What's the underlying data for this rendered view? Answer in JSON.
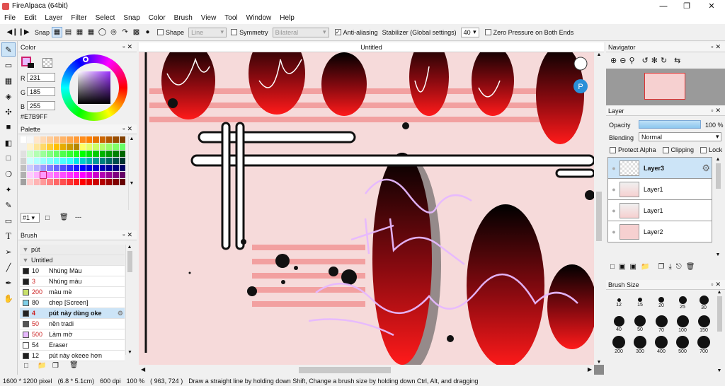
{
  "app": {
    "title": "FireAlpaca (64bit)"
  },
  "menu": [
    "File",
    "Edit",
    "Layer",
    "Filter",
    "Select",
    "Snap",
    "Color",
    "Brush",
    "View",
    "Tool",
    "Window",
    "Help"
  ],
  "toolbar": {
    "snap_label": "Snap",
    "shape_label": "Shape",
    "shape_value": "Line",
    "symmetry_label": "Symmetry",
    "symmetry_value": "Bilateral",
    "antialias_label": "Anti-aliasing",
    "stabilizer_label": "Stabilizer (Global settings)",
    "stabilizer_value": "40",
    "zero_pressure_label": "Zero Pressure on Both Ends"
  },
  "color_panel": {
    "title": "Color",
    "r_label": "R",
    "g_label": "G",
    "b_label": "B",
    "r": "231",
    "g": "185",
    "b": "255",
    "hex": "#E7B9FF",
    "color": "#E7B9FF"
  },
  "palette_panel": {
    "title": "Palette",
    "page": "#1",
    "more": "---"
  },
  "brush_panel": {
    "title": "Brush",
    "groups": [
      {
        "name": "pút"
      },
      {
        "name": "Untitled"
      }
    ],
    "items": [
      {
        "size": "10",
        "name": "Nhúng Màu",
        "color": "#222222",
        "size_color": "#111111"
      },
      {
        "size": "3",
        "name": "Nhúng màu",
        "color": "#222222",
        "size_color": "#cc2222"
      },
      {
        "size": "200",
        "name": "màu mè",
        "color": "#c8e06a",
        "size_color": "#cc2222"
      },
      {
        "size": "80",
        "name": "chep [Screen]",
        "color": "#7ecfe8",
        "size_color": "#111111"
      },
      {
        "size": "4",
        "name": "pút này dùng oke",
        "color": "#222222",
        "size_color": "#cc2222"
      },
      {
        "size": "50",
        "name": "nền tradi",
        "color": "#555555",
        "size_color": "#cc2222"
      },
      {
        "size": "500",
        "name": "Làm mờ",
        "color": "#e7b9ff",
        "size_color": "#cc2222"
      },
      {
        "size": "54",
        "name": "Eraser",
        "color": "#ffffff",
        "size_color": "#111111"
      },
      {
        "size": "12",
        "name": "pút này okeee hơn",
        "color": "#222222",
        "size_color": "#111111"
      }
    ]
  },
  "canvas": {
    "tab_title": "Untitled"
  },
  "navigator": {
    "title": "Navigator"
  },
  "layer_panel": {
    "title": "Layer",
    "opacity_label": "Opacity",
    "opacity_value": "100 %",
    "opacity": 1.0,
    "blending_label": "Blending",
    "blending_value": "Normal",
    "protect_alpha": "Protect Alpha",
    "clipping": "Clipping",
    "lock": "Lock",
    "layers": [
      {
        "name": "Layer3"
      },
      {
        "name": "Layer1"
      },
      {
        "name": "Layer1"
      },
      {
        "name": "Layer2"
      }
    ]
  },
  "brush_size_panel": {
    "title": "Brush Size",
    "sizes": [
      "12",
      "15",
      "20",
      "25",
      "30",
      "40",
      "50",
      "70",
      "100",
      "150",
      "200",
      "300",
      "400",
      "500",
      "700"
    ]
  },
  "status": {
    "dims": "1600 * 1200 pixel",
    "cm": "(6.8 * 5.1cm)",
    "dpi": "600 dpi",
    "zoom": "100 %",
    "coords": "( 963, 724 )",
    "hint": "Draw a straight line by holding down Shift, Change a brush size by holding down Ctrl, Alt, and dragging"
  },
  "colors": {
    "accent": "#99ccee",
    "selection": "#cce4f7"
  }
}
